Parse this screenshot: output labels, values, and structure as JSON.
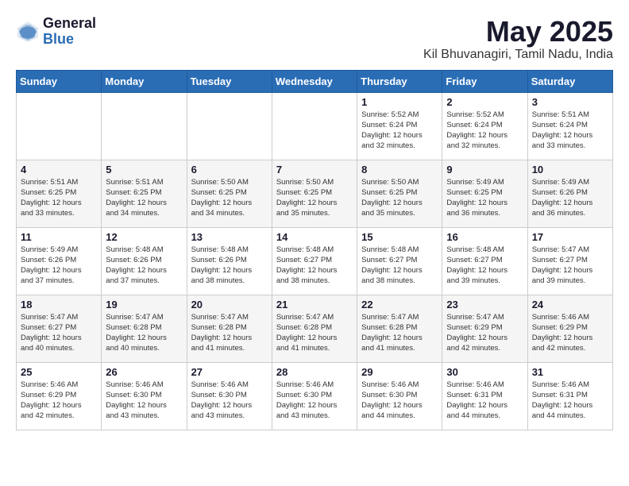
{
  "logo": {
    "general": "General",
    "blue": "Blue"
  },
  "title": {
    "month": "May 2025",
    "location": "Kil Bhuvanagiri, Tamil Nadu, India"
  },
  "headers": [
    "Sunday",
    "Monday",
    "Tuesday",
    "Wednesday",
    "Thursday",
    "Friday",
    "Saturday"
  ],
  "weeks": [
    [
      {
        "day": "",
        "info": ""
      },
      {
        "day": "",
        "info": ""
      },
      {
        "day": "",
        "info": ""
      },
      {
        "day": "",
        "info": ""
      },
      {
        "day": "1",
        "info": "Sunrise: 5:52 AM\nSunset: 6:24 PM\nDaylight: 12 hours\nand 32 minutes."
      },
      {
        "day": "2",
        "info": "Sunrise: 5:52 AM\nSunset: 6:24 PM\nDaylight: 12 hours\nand 32 minutes."
      },
      {
        "day": "3",
        "info": "Sunrise: 5:51 AM\nSunset: 6:24 PM\nDaylight: 12 hours\nand 33 minutes."
      }
    ],
    [
      {
        "day": "4",
        "info": "Sunrise: 5:51 AM\nSunset: 6:25 PM\nDaylight: 12 hours\nand 33 minutes."
      },
      {
        "day": "5",
        "info": "Sunrise: 5:51 AM\nSunset: 6:25 PM\nDaylight: 12 hours\nand 34 minutes."
      },
      {
        "day": "6",
        "info": "Sunrise: 5:50 AM\nSunset: 6:25 PM\nDaylight: 12 hours\nand 34 minutes."
      },
      {
        "day": "7",
        "info": "Sunrise: 5:50 AM\nSunset: 6:25 PM\nDaylight: 12 hours\nand 35 minutes."
      },
      {
        "day": "8",
        "info": "Sunrise: 5:50 AM\nSunset: 6:25 PM\nDaylight: 12 hours\nand 35 minutes."
      },
      {
        "day": "9",
        "info": "Sunrise: 5:49 AM\nSunset: 6:25 PM\nDaylight: 12 hours\nand 36 minutes."
      },
      {
        "day": "10",
        "info": "Sunrise: 5:49 AM\nSunset: 6:26 PM\nDaylight: 12 hours\nand 36 minutes."
      }
    ],
    [
      {
        "day": "11",
        "info": "Sunrise: 5:49 AM\nSunset: 6:26 PM\nDaylight: 12 hours\nand 37 minutes."
      },
      {
        "day": "12",
        "info": "Sunrise: 5:48 AM\nSunset: 6:26 PM\nDaylight: 12 hours\nand 37 minutes."
      },
      {
        "day": "13",
        "info": "Sunrise: 5:48 AM\nSunset: 6:26 PM\nDaylight: 12 hours\nand 38 minutes."
      },
      {
        "day": "14",
        "info": "Sunrise: 5:48 AM\nSunset: 6:27 PM\nDaylight: 12 hours\nand 38 minutes."
      },
      {
        "day": "15",
        "info": "Sunrise: 5:48 AM\nSunset: 6:27 PM\nDaylight: 12 hours\nand 38 minutes."
      },
      {
        "day": "16",
        "info": "Sunrise: 5:48 AM\nSunset: 6:27 PM\nDaylight: 12 hours\nand 39 minutes."
      },
      {
        "day": "17",
        "info": "Sunrise: 5:47 AM\nSunset: 6:27 PM\nDaylight: 12 hours\nand 39 minutes."
      }
    ],
    [
      {
        "day": "18",
        "info": "Sunrise: 5:47 AM\nSunset: 6:27 PM\nDaylight: 12 hours\nand 40 minutes."
      },
      {
        "day": "19",
        "info": "Sunrise: 5:47 AM\nSunset: 6:28 PM\nDaylight: 12 hours\nand 40 minutes."
      },
      {
        "day": "20",
        "info": "Sunrise: 5:47 AM\nSunset: 6:28 PM\nDaylight: 12 hours\nand 41 minutes."
      },
      {
        "day": "21",
        "info": "Sunrise: 5:47 AM\nSunset: 6:28 PM\nDaylight: 12 hours\nand 41 minutes."
      },
      {
        "day": "22",
        "info": "Sunrise: 5:47 AM\nSunset: 6:28 PM\nDaylight: 12 hours\nand 41 minutes."
      },
      {
        "day": "23",
        "info": "Sunrise: 5:47 AM\nSunset: 6:29 PM\nDaylight: 12 hours\nand 42 minutes."
      },
      {
        "day": "24",
        "info": "Sunrise: 5:46 AM\nSunset: 6:29 PM\nDaylight: 12 hours\nand 42 minutes."
      }
    ],
    [
      {
        "day": "25",
        "info": "Sunrise: 5:46 AM\nSunset: 6:29 PM\nDaylight: 12 hours\nand 42 minutes."
      },
      {
        "day": "26",
        "info": "Sunrise: 5:46 AM\nSunset: 6:30 PM\nDaylight: 12 hours\nand 43 minutes."
      },
      {
        "day": "27",
        "info": "Sunrise: 5:46 AM\nSunset: 6:30 PM\nDaylight: 12 hours\nand 43 minutes."
      },
      {
        "day": "28",
        "info": "Sunrise: 5:46 AM\nSunset: 6:30 PM\nDaylight: 12 hours\nand 43 minutes."
      },
      {
        "day": "29",
        "info": "Sunrise: 5:46 AM\nSunset: 6:30 PM\nDaylight: 12 hours\nand 44 minutes."
      },
      {
        "day": "30",
        "info": "Sunrise: 5:46 AM\nSunset: 6:31 PM\nDaylight: 12 hours\nand 44 minutes."
      },
      {
        "day": "31",
        "info": "Sunrise: 5:46 AM\nSunset: 6:31 PM\nDaylight: 12 hours\nand 44 minutes."
      }
    ]
  ]
}
